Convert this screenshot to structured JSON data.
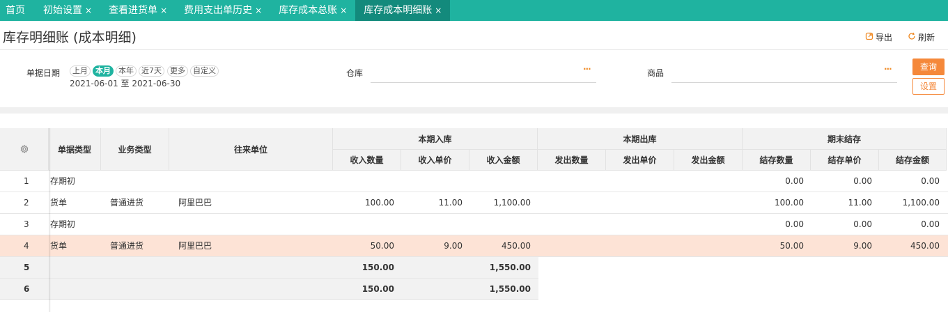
{
  "tabs": [
    {
      "label": "首页",
      "closable": false,
      "active": false
    },
    {
      "label": "初始设置",
      "closable": true,
      "active": false
    },
    {
      "label": "查看进货单",
      "closable": true,
      "active": false
    },
    {
      "label": "费用支出单历史",
      "closable": true,
      "active": false
    },
    {
      "label": "库存成本总账",
      "closable": true,
      "active": false
    },
    {
      "label": "库存成本明细账",
      "closable": true,
      "active": true
    }
  ],
  "close_glyph": "×",
  "header": {
    "title": "库存明细账 (成本明细)",
    "export_label": "导出",
    "refresh_label": "刷新"
  },
  "filter": {
    "date_label": "单据日期",
    "quick_dates": [
      "上月",
      "本月",
      "本年",
      "近7天",
      "更多",
      "自定义"
    ],
    "active_quick_date": "本月",
    "date_range": "2021-06-01 至 2021-06-30",
    "warehouse_label": "仓库",
    "warehouse_value": "",
    "product_label": "商品",
    "product_value": "",
    "picker_glyph": "···",
    "query_label": "查询",
    "settings_label": "设置"
  },
  "table": {
    "headers": {
      "doc_type": "单据类型",
      "biz_type": "业务类型",
      "partner": "往来单位",
      "in_group": "本期入库",
      "out_group": "本期出库",
      "end_group": "期末结存",
      "in_qty": "收入数量",
      "in_price": "收入单价",
      "in_amount": "收入金额",
      "out_qty": "发出数量",
      "out_price": "发出单价",
      "out_amount": "发出金额",
      "end_qty": "结存数量",
      "end_price": "结存单价",
      "end_amount": "结存金额"
    },
    "rows": [
      {
        "no": "1",
        "doc_type": "存期初",
        "biz_type": "",
        "partner": "",
        "in_qty": "",
        "in_price": "",
        "in_amount": "",
        "out_qty": "",
        "out_price": "",
        "out_amount": "",
        "end_qty": "0.00",
        "end_price": "0.00",
        "end_amount": "0.00",
        "highlight": false
      },
      {
        "no": "2",
        "doc_type": "货单",
        "biz_type": "普通进货",
        "partner": "阿里巴巴",
        "in_qty": "100.00",
        "in_price": "11.00",
        "in_amount": "1,100.00",
        "out_qty": "",
        "out_price": "",
        "out_amount": "",
        "end_qty": "100.00",
        "end_price": "11.00",
        "end_amount": "1,100.00",
        "highlight": false
      },
      {
        "no": "3",
        "doc_type": "存期初",
        "biz_type": "",
        "partner": "",
        "in_qty": "",
        "in_price": "",
        "in_amount": "",
        "out_qty": "",
        "out_price": "",
        "out_amount": "",
        "end_qty": "0.00",
        "end_price": "0.00",
        "end_amount": "0.00",
        "highlight": false
      },
      {
        "no": "4",
        "doc_type": "货单",
        "biz_type": "普通进货",
        "partner": "阿里巴巴",
        "in_qty": "50.00",
        "in_price": "9.00",
        "in_amount": "450.00",
        "out_qty": "",
        "out_price": "",
        "out_amount": "",
        "end_qty": "50.00",
        "end_price": "9.00",
        "end_amount": "450.00",
        "highlight": true
      }
    ],
    "summary_rows": [
      {
        "no": "5",
        "in_qty": "150.00",
        "in_amount": "1,550.00"
      },
      {
        "no": "6",
        "in_qty": "150.00",
        "in_amount": "1,550.00"
      }
    ]
  },
  "colors": {
    "tab_bar": "#1fb3a0",
    "tab_active": "#138a7c",
    "accent_orange": "#f5883a",
    "row_highlight": "#fde3d6"
  },
  "icons": {
    "export": "export-icon",
    "refresh": "refresh-icon",
    "column_settings": "gear-icon"
  }
}
